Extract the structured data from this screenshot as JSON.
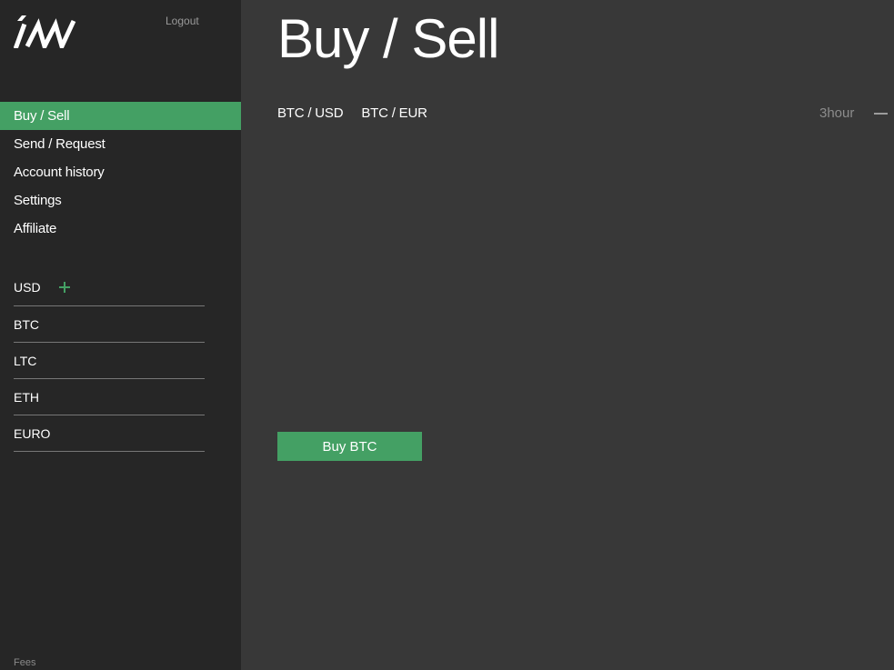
{
  "sidebar": {
    "logo_name": "logo-icon",
    "logout_label": "Logout",
    "nav": [
      {
        "label": "Buy / Sell",
        "active": true
      },
      {
        "label": "Send / Request"
      },
      {
        "label": "Account history"
      },
      {
        "label": "Settings"
      },
      {
        "label": "Affiliate"
      }
    ],
    "wallets": [
      {
        "label": "USD",
        "has_add": true
      },
      {
        "label": "BTC"
      },
      {
        "label": "LTC"
      },
      {
        "label": "ETH"
      },
      {
        "label": "EURO"
      }
    ],
    "fees_label": "Fees"
  },
  "main": {
    "title": "Buy / Sell",
    "pairs": [
      {
        "label": "BTC / USD"
      },
      {
        "label": "BTC / EUR"
      }
    ],
    "timeframe": "3hour",
    "dash": "—",
    "buy_button": "Buy BTC"
  },
  "colors": {
    "accent": "#44a064",
    "sidebar_bg": "#262626",
    "main_bg": "#383838"
  }
}
